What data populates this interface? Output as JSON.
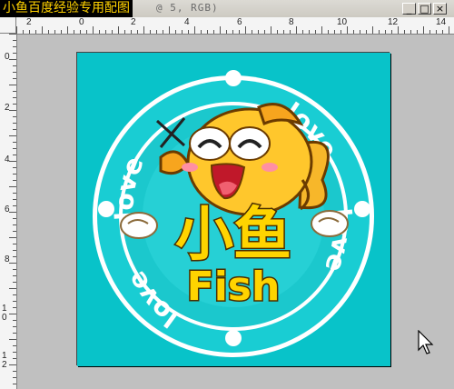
{
  "window": {
    "title_overlay": "小鱼百度经验专用配图",
    "title_rest": "@ 5, RGB)",
    "buttons": [
      "_",
      "□",
      "×"
    ]
  },
  "ruler_top": [
    "2",
    "0",
    "2",
    "4",
    "6",
    "8",
    "10",
    "12",
    "14"
  ],
  "ruler_left": [
    "0",
    "2",
    "4",
    "6",
    "8",
    "1 0",
    "1 2"
  ],
  "artwork": {
    "arc_words": [
      "love",
      "love",
      "love",
      "love"
    ],
    "big_text": "小鱼",
    "sub_text": "Fish",
    "background_color": "#08c3c9",
    "text_color": "#ffd400"
  }
}
